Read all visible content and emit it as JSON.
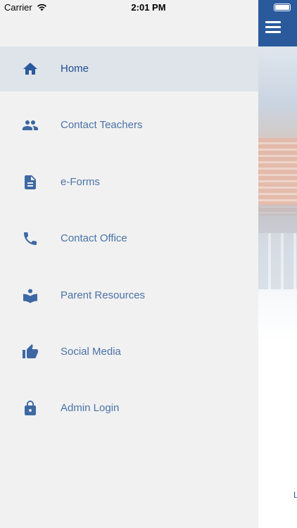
{
  "status_bar": {
    "carrier": "Carrier",
    "time": "2:01 PM"
  },
  "drawer": {
    "items": [
      {
        "label": "Home",
        "icon": "home-icon",
        "active": true
      },
      {
        "label": "Contact Teachers",
        "icon": "people-icon"
      },
      {
        "label": "e-Forms",
        "icon": "document-icon"
      },
      {
        "label": "Contact Office",
        "icon": "phone-icon"
      },
      {
        "label": "Parent Resources",
        "icon": "reading-book-icon"
      },
      {
        "label": "Social Media",
        "icon": "thumbs-up-icon"
      },
      {
        "label": "Admin Login",
        "icon": "lock-icon"
      }
    ]
  },
  "main": {
    "edge_text": "L"
  },
  "colors": {
    "nav_bar": "#2a5a9c",
    "drawer_bg": "#f1f1f1",
    "active_row": "#dfe3ea",
    "label_text": "#4a73a8",
    "active_text": "#1e4f92",
    "icon": "#3d68a3"
  }
}
